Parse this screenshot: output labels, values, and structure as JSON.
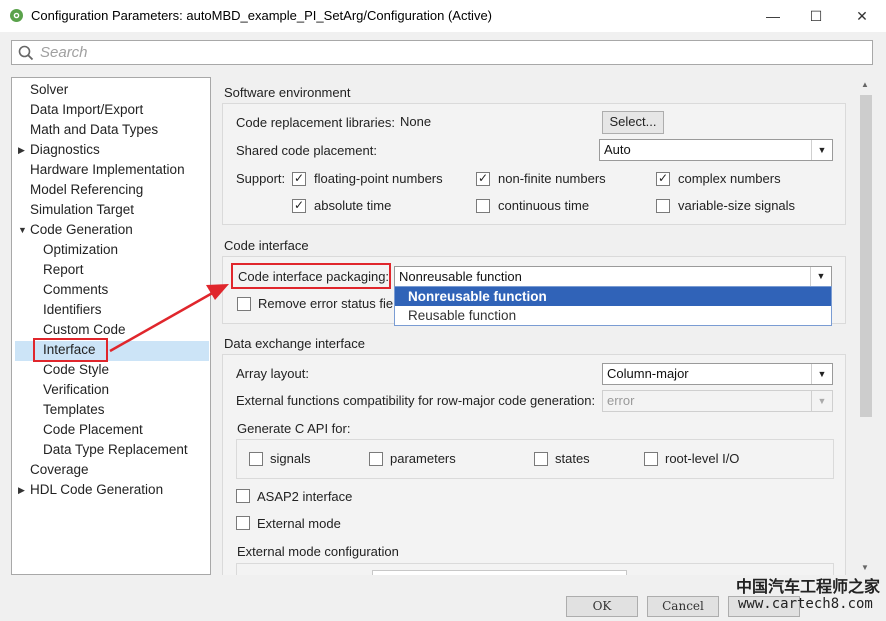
{
  "window": {
    "title": "Configuration Parameters: autoMBD_example_PI_SetArg/Configuration (Active)",
    "app_icon": "gear-cog-icon",
    "controls": [
      "minimize-icon",
      "maximize-icon",
      "close-icon"
    ]
  },
  "search": {
    "placeholder": "Search"
  },
  "tree": {
    "items": [
      {
        "label": "Solver",
        "level": 0,
        "expandable": false
      },
      {
        "label": "Data Import/Export",
        "level": 0,
        "expandable": false
      },
      {
        "label": "Math and Data Types",
        "level": 0,
        "expandable": false
      },
      {
        "label": "Diagnostics",
        "level": 0,
        "expandable": true,
        "expanded": false
      },
      {
        "label": "Hardware Implementation",
        "level": 0,
        "expandable": false
      },
      {
        "label": "Model Referencing",
        "level": 0,
        "expandable": false
      },
      {
        "label": "Simulation Target",
        "level": 0,
        "expandable": false
      },
      {
        "label": "Code Generation",
        "level": 0,
        "expandable": true,
        "expanded": true
      },
      {
        "label": "Optimization",
        "level": 1
      },
      {
        "label": "Report",
        "level": 1
      },
      {
        "label": "Comments",
        "level": 1
      },
      {
        "label": "Identifiers",
        "level": 1
      },
      {
        "label": "Custom Code",
        "level": 1
      },
      {
        "label": "Interface",
        "level": 1,
        "selected": true
      },
      {
        "label": "Code Style",
        "level": 1
      },
      {
        "label": "Verification",
        "level": 1
      },
      {
        "label": "Templates",
        "level": 1
      },
      {
        "label": "Code Placement",
        "level": 1
      },
      {
        "label": "Data Type Replacement",
        "level": 1
      },
      {
        "label": "Coverage",
        "level": 0,
        "expandable": false
      },
      {
        "label": "HDL Code Generation",
        "level": 0,
        "expandable": true,
        "expanded": false
      }
    ]
  },
  "software_env": {
    "title": "Software environment",
    "crl_label": "Code replacement libraries:",
    "crl_value": "None",
    "select_button": "Select...",
    "shared_label": "Shared code placement:",
    "shared_value": "Auto",
    "support_label": "Support:",
    "support": [
      {
        "label": "floating-point numbers",
        "checked": true
      },
      {
        "label": "non-finite numbers",
        "checked": true
      },
      {
        "label": "complex numbers",
        "checked": true
      },
      {
        "label": "absolute time",
        "checked": true
      },
      {
        "label": "continuous time",
        "checked": false
      },
      {
        "label": "variable-size signals",
        "checked": false
      }
    ]
  },
  "code_interface": {
    "title": "Code interface",
    "packaging_label": "Code interface packaging:",
    "packaging_value": "Nonreusable function",
    "remove_error_label": "Remove error status fie",
    "options": [
      "Nonreusable function",
      "Reusable function"
    ],
    "selected_option": "Nonreusable function"
  },
  "data_exchange": {
    "title": "Data exchange interface",
    "array_layout_label": "Array layout:",
    "array_layout_value": "Column-major",
    "ext_compat_label": "External functions compatibility for row-major code generation:",
    "ext_compat_value": "error",
    "c_api_label": "Generate C API for:",
    "c_api": [
      {
        "label": "signals",
        "checked": false
      },
      {
        "label": "parameters",
        "checked": false
      },
      {
        "label": "states",
        "checked": false
      },
      {
        "label": "root-level I/O",
        "checked": false
      }
    ],
    "asap2_label": "ASAP2 interface",
    "external_mode_label": "External mode",
    "ext_mode_config_label": "External mode configuration"
  },
  "bottom_buttons": {
    "ok": "OK",
    "cancel": "Cancel"
  },
  "watermark": {
    "text_cn": "中国汽车工程师之家",
    "url": "www.cartech8.com"
  },
  "colors": {
    "highlight": "#e0262c",
    "selection": "#cce4f7",
    "dropdown_selected": "#3063b8"
  }
}
